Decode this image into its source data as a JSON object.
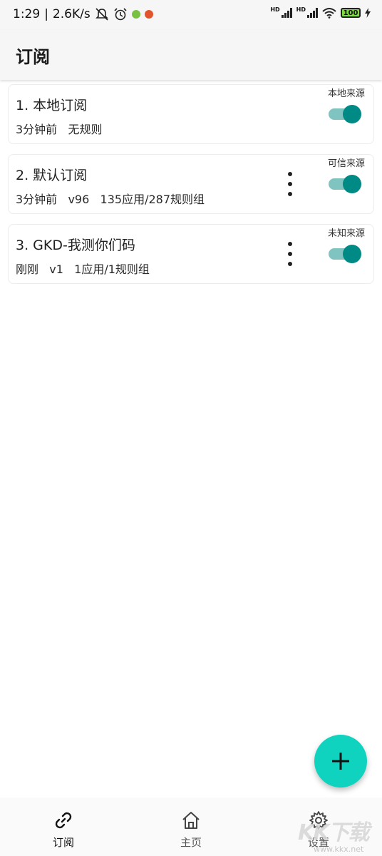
{
  "status_bar": {
    "time": "1:29",
    "separator": "|",
    "speed": "2.6K/s",
    "hd1": "HD",
    "hd2": "HD",
    "battery": "100"
  },
  "app_bar": {
    "title": "订阅"
  },
  "subscriptions": [
    {
      "title": "1. 本地订阅",
      "subtitle": "3分钟前   无规则",
      "source": "本地来源",
      "has_menu": false,
      "enabled": true
    },
    {
      "title": "2. 默认订阅",
      "subtitle": "3分钟前   v96   135应用/287规则组",
      "source": "可信来源",
      "has_menu": true,
      "enabled": true
    },
    {
      "title": "3. GKD-我测你们码",
      "subtitle": "刚刚   v1   1应用/1规则组",
      "source": "未知来源",
      "has_menu": true,
      "enabled": true
    }
  ],
  "bottom_nav": {
    "items": [
      {
        "label": "订阅",
        "icon": "link-icon",
        "active": true
      },
      {
        "label": "主页",
        "icon": "home-icon",
        "active": false
      },
      {
        "label": "设置",
        "icon": "gear-icon",
        "active": false
      }
    ]
  },
  "watermark": {
    "text": "KK下载",
    "url": "www.kkx.net"
  },
  "colors": {
    "accent": "#008a86",
    "switch_track": "#7fc4c0",
    "fab": "#10d3bf",
    "app_bar_bg": "#f6f6f6"
  }
}
